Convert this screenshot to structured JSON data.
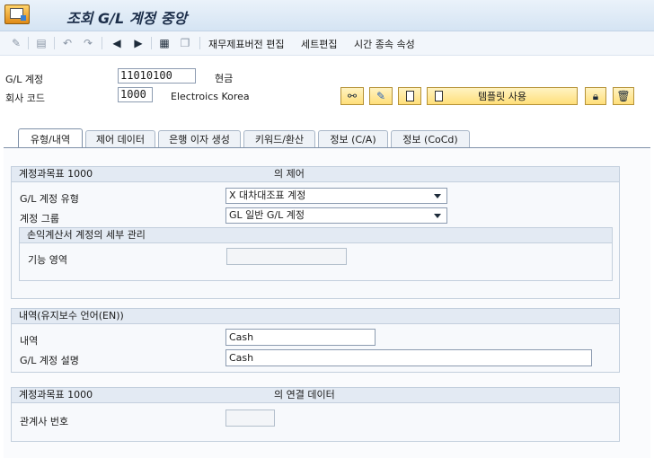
{
  "window": {
    "title": "조회 G/L 계정 중앙"
  },
  "toolbar": {
    "items": [
      "재무제표버전 편집",
      "세트편집",
      "시간 종속 속성"
    ]
  },
  "header": {
    "gl_account_label": "G/L 계정",
    "gl_account_value": "11010100",
    "gl_account_text": "현금",
    "company_code_label": "회사 코드",
    "company_code_value": "1000",
    "company_code_text": "Electroics Korea"
  },
  "actions": {
    "template_label": "템플릿 사용"
  },
  "tabs": [
    {
      "label": "유형/내역",
      "active": true
    },
    {
      "label": "제어 데이터",
      "active": false
    },
    {
      "label": "은행 이자 생성",
      "active": false
    },
    {
      "label": "키워드/환산",
      "active": false
    },
    {
      "label": "정보 (C/A)",
      "active": false
    },
    {
      "label": "정보 (CoCd)",
      "active": false
    }
  ],
  "control_group": {
    "title_left": "계정과목표 1000",
    "title_right": "의 제어",
    "type_label": "G/L 계정 유형",
    "type_value": "X 대차대조표 계정",
    "group_label": "계정 그룹",
    "group_value": "GL 일반 G/L 계정",
    "pl_subgroup_title": "손익계산서 계정의 세부 관리",
    "functional_area_label": "기능 영역",
    "functional_area_value": ""
  },
  "description_group": {
    "title": "내역(유지보수 언어(EN))",
    "short_label": "내역",
    "short_value": "Cash",
    "long_label": "G/L 계정 설명",
    "long_value": "Cash"
  },
  "consolidation_group": {
    "title_left": "계정과목표 1000",
    "title_right": "의 연결 데이터",
    "trading_partner_label": "관계사 번호",
    "trading_partner_value": ""
  },
  "colors": {
    "title_bg": "#d5e4f3",
    "button_yellow": "#ffdf7a",
    "group_header": "#e3eaf3"
  }
}
